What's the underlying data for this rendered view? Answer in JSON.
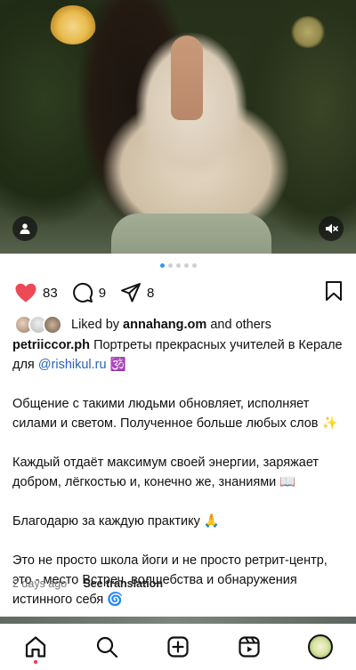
{
  "post": {
    "media": {
      "slide_count": 5,
      "active_slide": 1,
      "tag_icon": "person-icon",
      "mute_icon": "speaker-muted-icon"
    },
    "actions": {
      "likes": "83",
      "comments": "9",
      "shares": "8",
      "like_color": "#ed4956"
    },
    "liked_by": {
      "prefix": "Liked by",
      "user": "annahang.om",
      "suffix": "and others"
    },
    "caption": {
      "username": "petriiccor.ph",
      "line1_text": "Портреты прекрасных учителей в Керале для",
      "mention": "@rishikul.ru",
      "line1_emoji": "🕉️",
      "para2": "Общение с такими людьми обновляет, исполняет силами и светом. Полученное больше любых слов ✨",
      "para3": "Каждый отдаёт максимум своей энергии, заряжает добром, лёгкостью и, конечно же, знаниями 📖",
      "para4": "Благодарю за каждую практику 🙏",
      "para5": "Это не просто школа йоги и не просто ретрит-центр, это - место Встреч, волшебства и обнаружения истинного себя 🌀"
    },
    "timestamp": "2 days ago",
    "separator": "·",
    "see_translation": "See translation"
  },
  "bottom_nav": {
    "items": [
      "home-icon",
      "search-icon",
      "create-icon",
      "reels-icon",
      "profile-avatar"
    ],
    "active": "home-icon",
    "notification_color": "#ff3040"
  }
}
